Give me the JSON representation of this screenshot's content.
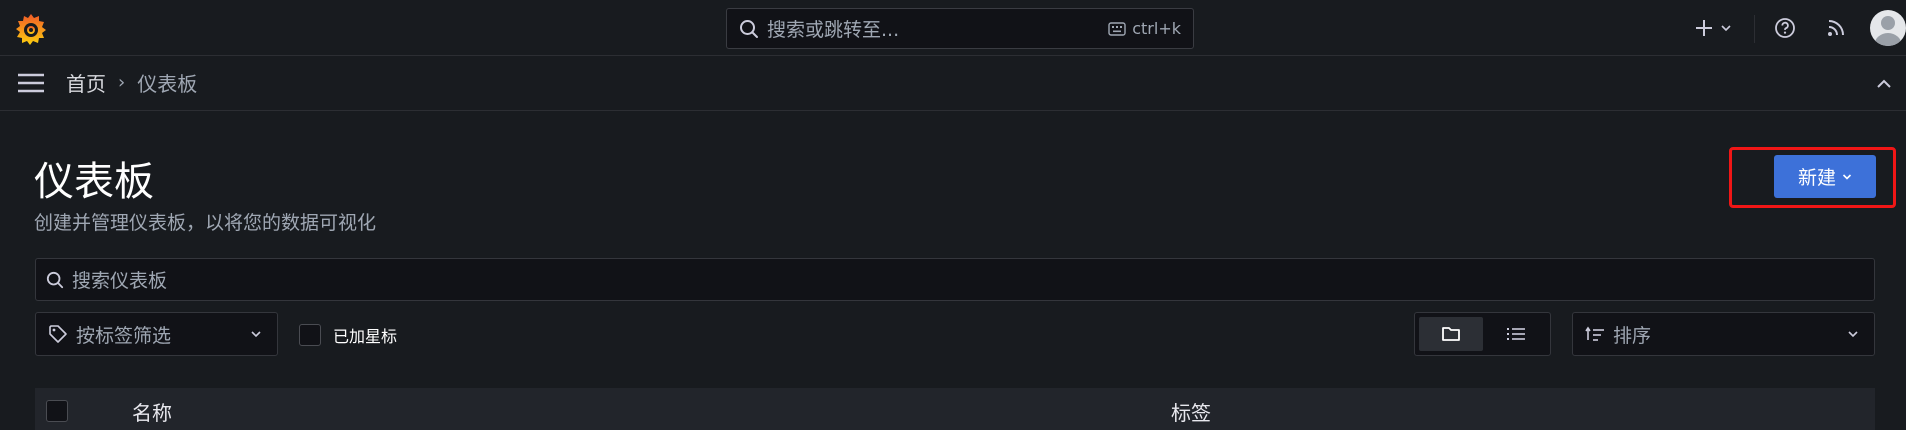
{
  "topbar": {
    "search_placeholder": "搜索或跳转至...",
    "shortcut": "ctrl+k",
    "icons": [
      "grafana-logo-icon",
      "search-icon",
      "keyboard-icon",
      "plus-icon",
      "chevron-down-icon",
      "help-icon",
      "rss-icon",
      "avatar"
    ]
  },
  "breadcrumb": {
    "home": "首页",
    "separator": "›",
    "current": "仪表板"
  },
  "page": {
    "title": "仪表板",
    "subtitle": "创建并管理仪表板，以将您的数据可视化",
    "new_button": "新建"
  },
  "filters": {
    "search_placeholder": "搜索仪表板",
    "tag_filter": "按标签筛选",
    "starred_label": "已加星标",
    "sort_label": "排序",
    "view_mode": "folder"
  },
  "table": {
    "columns": [
      "名称",
      "标签"
    ]
  },
  "colors": {
    "accent": "#3d71d9",
    "highlight_box": "#f01616",
    "logo_orange": "#f46800"
  }
}
